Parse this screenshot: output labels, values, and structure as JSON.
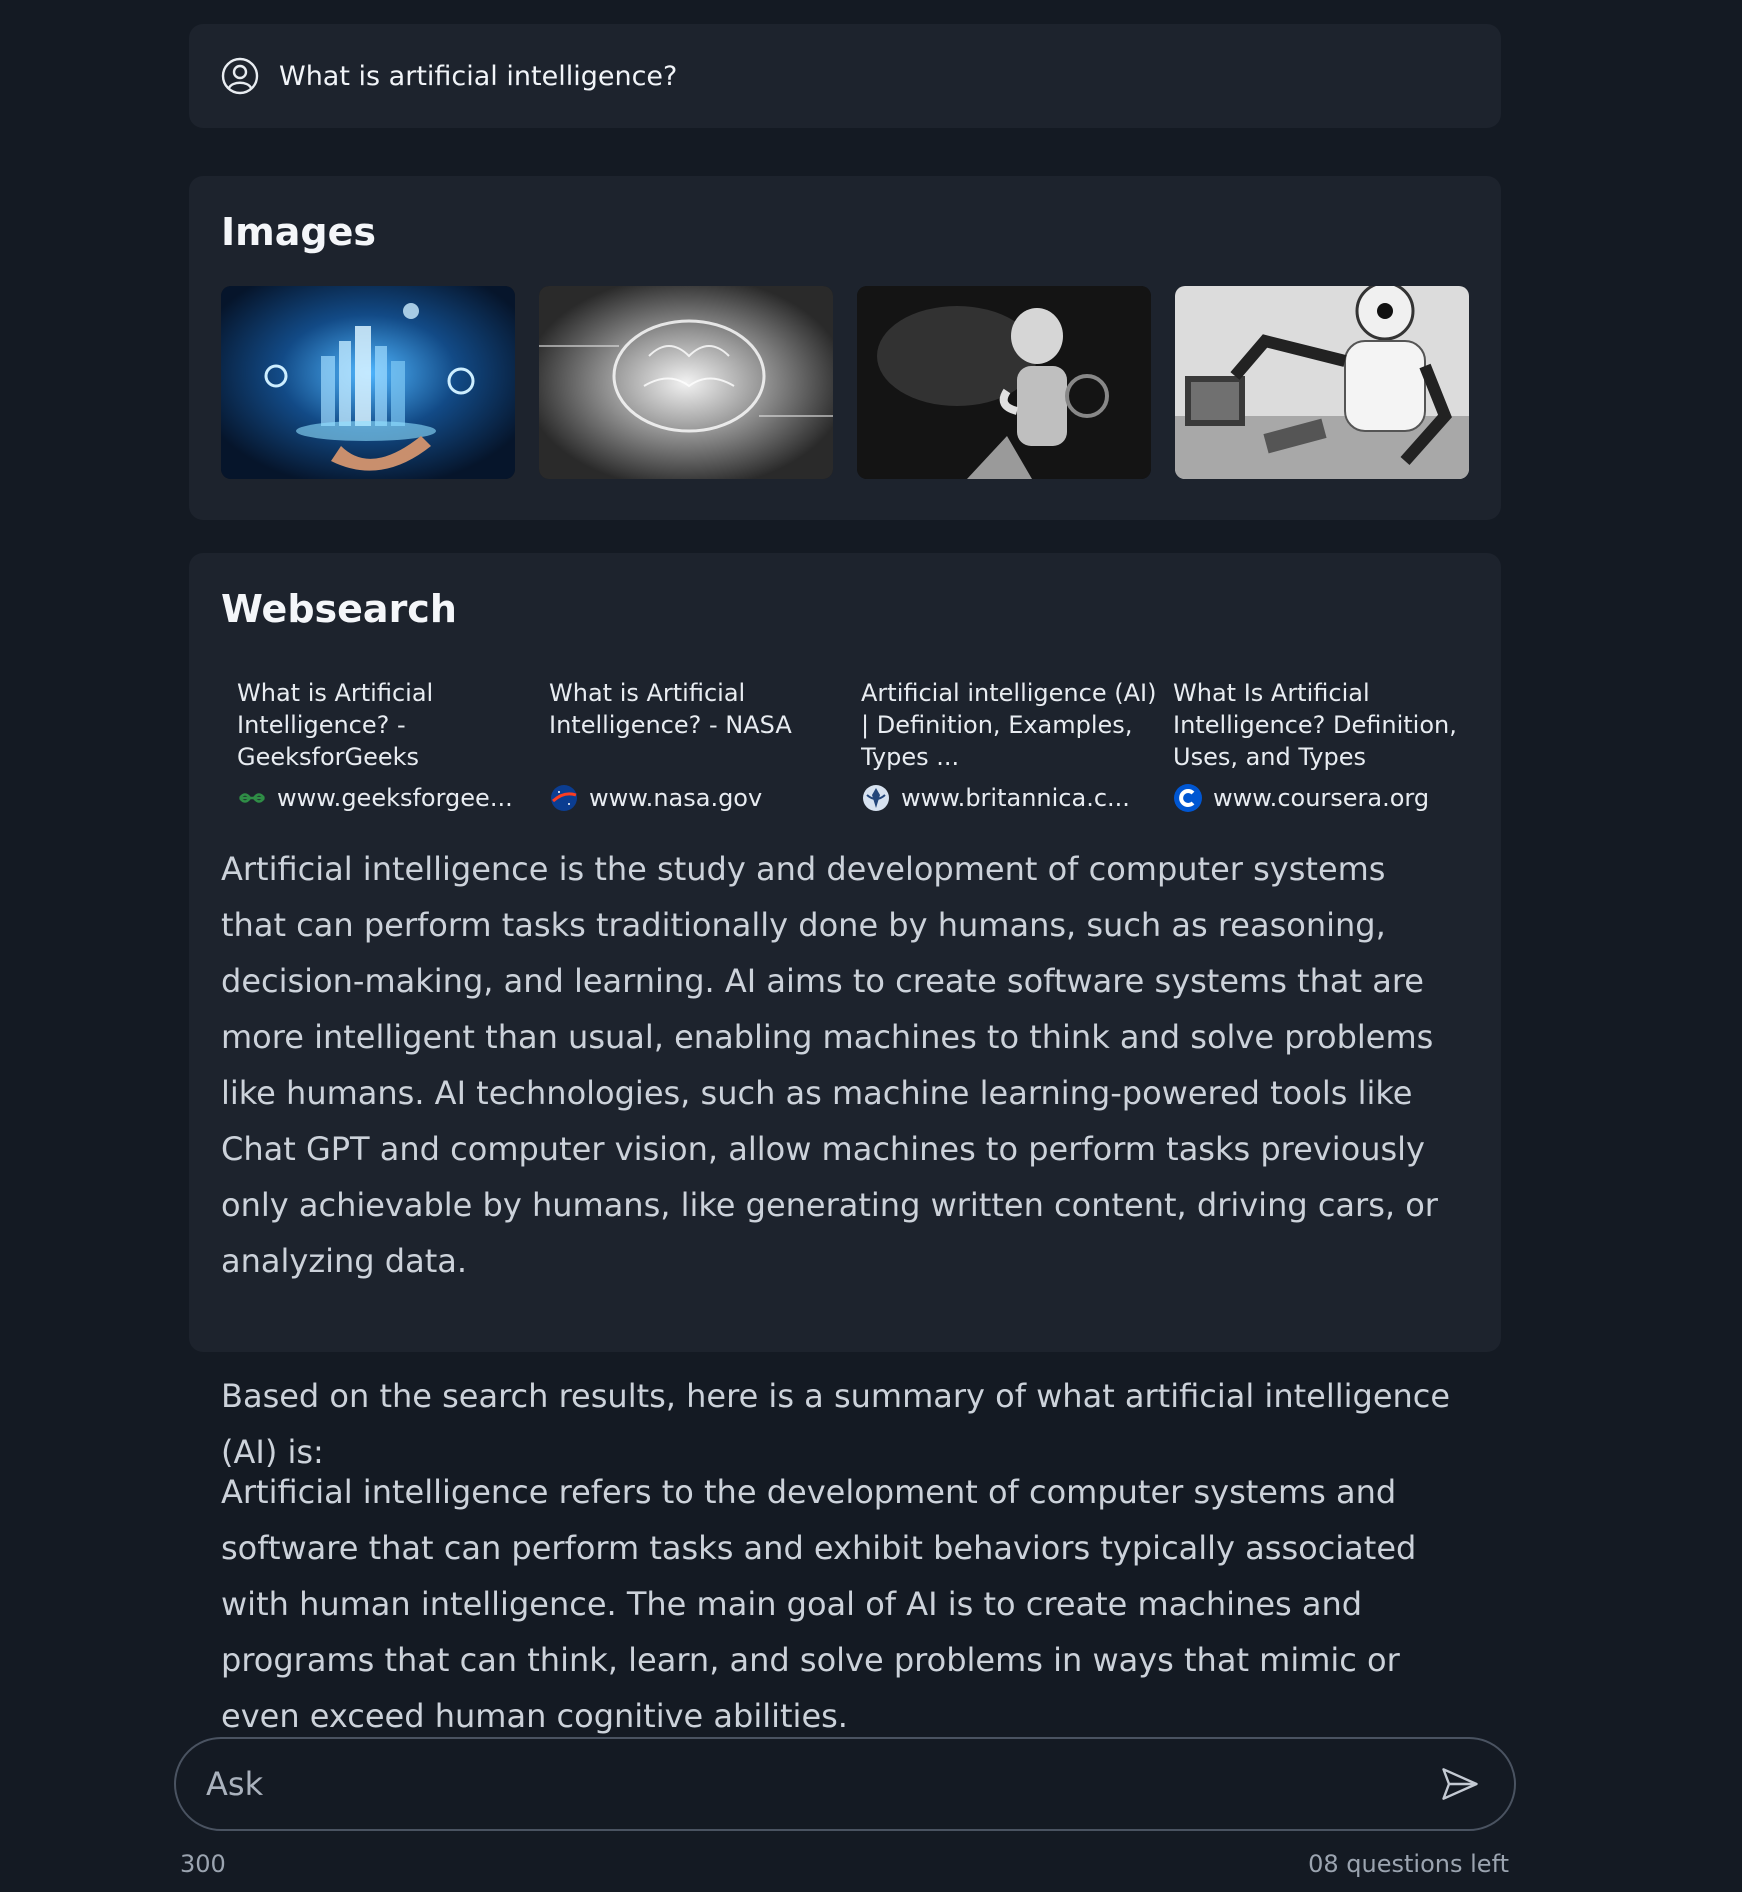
{
  "question": {
    "icon": "user-circle-icon",
    "text": "What is artificial intelligence?"
  },
  "images": {
    "title": "Images",
    "items": [
      {
        "alt": "AI city hologram over hand"
      },
      {
        "alt": "Glowing brain circuit"
      },
      {
        "alt": "Thinking robot"
      },
      {
        "alt": "Robot arms at desk"
      }
    ]
  },
  "websearch": {
    "title": "Websearch",
    "sources": [
      {
        "title": "What is Artificial Intelligence? - GeeksforGeeks",
        "domain": "www.geeksforgee...",
        "icon": "geeksforgeeks-icon"
      },
      {
        "title": "What is Artificial Intelligence? - NASA",
        "domain": "www.nasa.gov",
        "icon": "nasa-icon"
      },
      {
        "title": "Artificial intelligence (AI) | Definition, Examples, Types ...",
        "domain": "www.britannica.c...",
        "icon": "britannica-icon"
      },
      {
        "title": "What Is Artificial Intelligence? Definition, Uses, and Types",
        "domain": "www.coursera.org",
        "icon": "coursera-icon"
      }
    ],
    "text": "Artificial intelligence is the study and development of computer systems that can perform tasks traditionally done by humans, such as reasoning, decision-making, and learning. AI aims to create software systems that are more intelligent than usual, enabling machines to think and solve problems like humans. AI technologies, such as machine learning-powered tools like Chat GPT and computer vision, allow machines to perform tasks previously only achievable by humans, like generating written content, driving cars, or analyzing data."
  },
  "summary": {
    "intro": "Based on the search results, here is a summary of what artificial intelligence (AI) is:",
    "body": "Artificial intelligence refers to the development of computer systems and software that can perform tasks and exhibit behaviors typically associated with human intelligence. The main goal of AI is to create machines and programs that can think, learn, and solve problems in ways that mimic or even exceed human cognitive abilities."
  },
  "ask": {
    "placeholder": "Ask",
    "char_limit": "300",
    "questions_left": "08 questions left",
    "send_icon": "send-icon"
  },
  "colors": {
    "background": "#141a23",
    "card": "#1d232d",
    "text": "#e8ecf1",
    "muted": "#9ba4b0"
  }
}
